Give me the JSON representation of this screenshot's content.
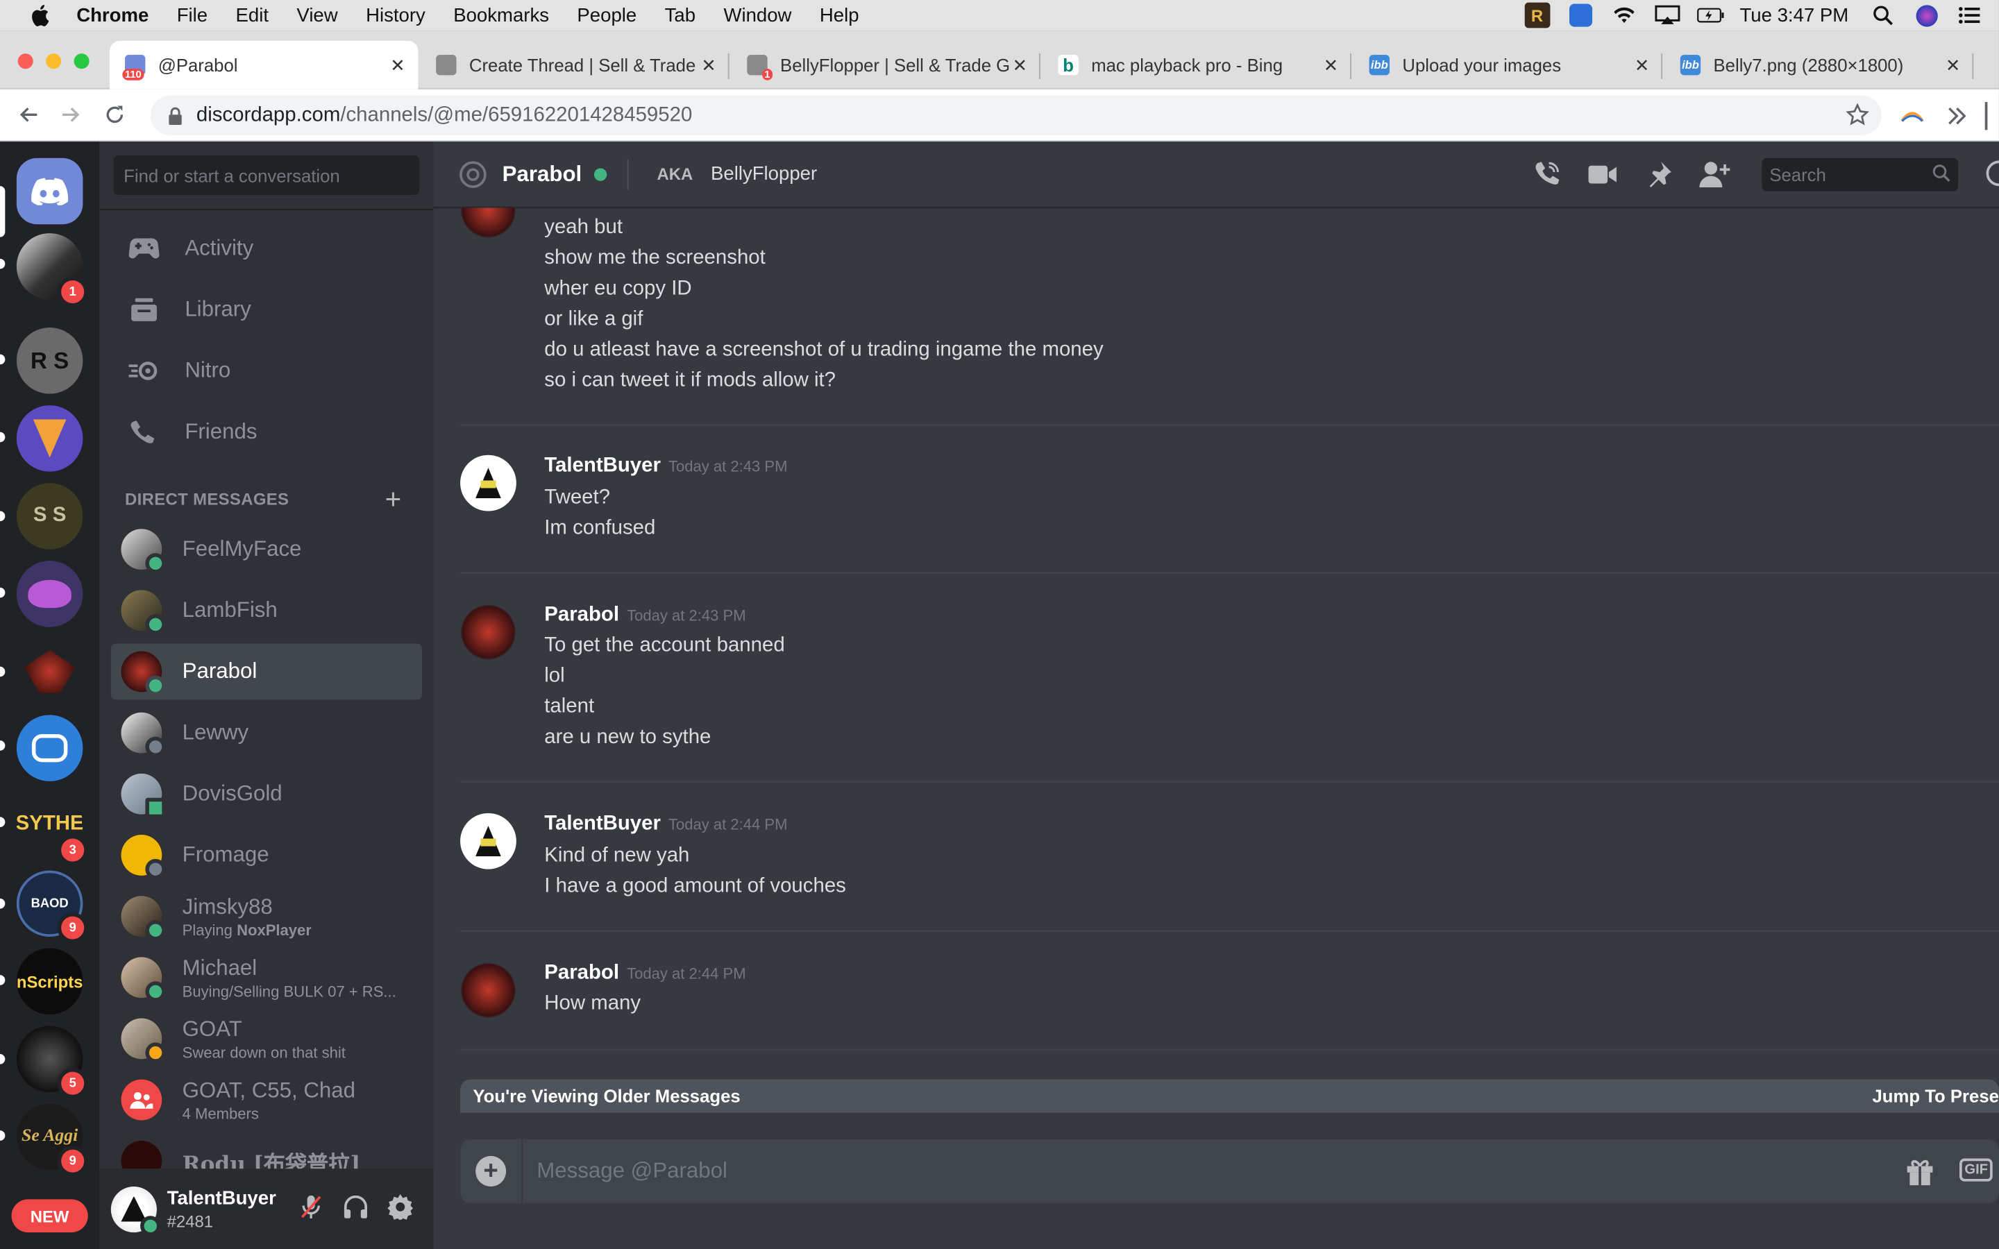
{
  "menubar": {
    "app": "Chrome",
    "items": [
      "File",
      "Edit",
      "View",
      "History",
      "Bookmarks",
      "People",
      "Tab",
      "Window",
      "Help"
    ],
    "clock": "Tue 3:47 PM"
  },
  "tabs": [
    {
      "title": "@Parabol",
      "badge": "110",
      "active": true
    },
    {
      "title": "Create Thread | Sell & Trade",
      "active": false
    },
    {
      "title": "BellyFlopper | Sell & Trade G",
      "badge": "1",
      "active": false
    },
    {
      "title": "mac playback pro - Bing",
      "active": false
    },
    {
      "title": "Upload your images",
      "active": false
    },
    {
      "title": "Belly7.png (2880×1800)",
      "active": false
    }
  ],
  "omnibox": {
    "host": "discordapp.com",
    "path": "/channels/@me/659162201428459520"
  },
  "guilds": {
    "badges": [
      "1",
      "3",
      "9",
      "5",
      "9"
    ],
    "labels": [
      "R S",
      "S S",
      "SYTHE",
      "BAOD",
      "nScripts",
      "Se Aggi"
    ],
    "new_label": "NEW"
  },
  "sidebar": {
    "search_placeholder": "Find or start a conversation",
    "nav": [
      "Activity",
      "Library",
      "Nitro",
      "Friends"
    ],
    "dm_header": "DIRECT MESSAGES",
    "dms": [
      {
        "name": "FeelMyFace"
      },
      {
        "name": "LambFish"
      },
      {
        "name": "Parabol"
      },
      {
        "name": "Lewwy"
      },
      {
        "name": "DovisGold"
      },
      {
        "name": "Fromage"
      },
      {
        "name": "Jimsky88",
        "sub_prefix": "Playing ",
        "sub_bold": "NoxPlayer"
      },
      {
        "name": "Michael",
        "sub": "Buying/Selling BULK 07 + RS..."
      },
      {
        "name": "GOAT",
        "sub": "Swear down on that shit"
      },
      {
        "name": "GOAT, C55, Chad",
        "sub": "4 Members"
      },
      {
        "name": "Rodu [布袋普拉]"
      }
    ]
  },
  "user": {
    "name": "TalentBuyer",
    "tag": "#2481"
  },
  "header": {
    "name": "Parabol",
    "aka_label": "AKA",
    "aka_name": "BellyFlopper",
    "search_placeholder": "Search"
  },
  "messages": {
    "first_group": [
      "yeah but",
      "show me the screenshot",
      "wher eu copy ID",
      "or like a gif",
      "do u atleast have a screenshot of u trading ingame the money",
      "so i can tweet it if mods allow it?"
    ],
    "groups": [
      {
        "author": "TalentBuyer",
        "time": "Today at 2:43 PM",
        "lines": [
          "Tweet?",
          "Im confused"
        ]
      },
      {
        "author": "Parabol",
        "time": "Today at 2:43 PM",
        "lines": [
          "To get the account banned",
          "lol",
          "talent",
          "are u new to sythe"
        ]
      },
      {
        "author": "TalentBuyer",
        "time": "Today at 2:44 PM",
        "lines": [
          "Kind of new yah",
          "I have a good amount of vouches"
        ]
      },
      {
        "author": "Parabol",
        "time": "Today at 2:44 PM",
        "lines": [
          "How many"
        ]
      }
    ]
  },
  "older_bar": {
    "label": "You're Viewing Older Messages",
    "jump": "Jump To Prese"
  },
  "composer": {
    "placeholder": "Message @Parabol",
    "gif": "GIF"
  }
}
